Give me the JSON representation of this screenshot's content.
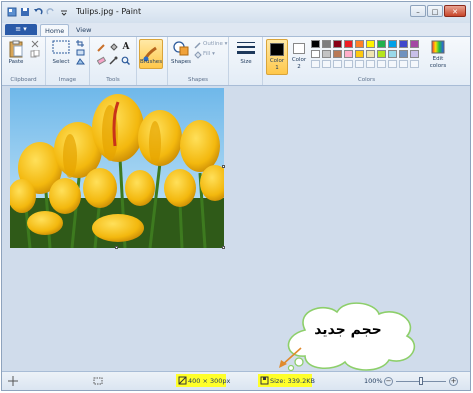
{
  "window": {
    "title": "Tulips.jpg - Paint",
    "controls": {
      "minimize": "–",
      "maximize": "□",
      "close": "✕"
    }
  },
  "quick_access": {
    "icons": [
      "paint-icon",
      "save-icon",
      "undo-icon",
      "redo-icon",
      "customize-icon"
    ]
  },
  "tabs": {
    "file": "≡ ▾",
    "home": "Home",
    "view": "View"
  },
  "ribbon": {
    "clipboard": {
      "paste": "Paste",
      "group_label": "Clipboard"
    },
    "image": {
      "select": "Select",
      "group_label": "Image"
    },
    "tools": {
      "group_label": "Tools",
      "text_tool": "A"
    },
    "brushes": {
      "label": "Brushes"
    },
    "shapes": {
      "label": "Shapes",
      "outline": "Outline ▾",
      "fill": "Fill ▾",
      "group_label": "Shapes"
    },
    "size": {
      "label": "Size"
    },
    "colors": {
      "color1": "Color\n1",
      "color2": "Color\n2",
      "color1_value": "#000000",
      "color2_value": "#ffffff",
      "edit": "Edit\ncolors",
      "group_label": "Colors",
      "palette_row1": [
        "#000000",
        "#7f7f7f",
        "#880015",
        "#ed1c24",
        "#ff7f27",
        "#fff200",
        "#22b14c",
        "#00a2e8",
        "#3f48cc",
        "#a349a4"
      ],
      "palette_row2": [
        "#ffffff",
        "#c3c3c3",
        "#b97a57",
        "#ffaec9",
        "#ffc90e",
        "#efe4b0",
        "#b5e61d",
        "#99d9ea",
        "#7092be",
        "#c8bfe7"
      ]
    }
  },
  "canvas": {
    "image_name": "Tulips.jpg",
    "annotation": "حجم جديد"
  },
  "status": {
    "dimensions": "400 × 300px",
    "size": "Size: 339.2KB",
    "zoom": "100%",
    "zoom_out": "−",
    "zoom_in": "+"
  },
  "highlight_color": "#ffff2a"
}
